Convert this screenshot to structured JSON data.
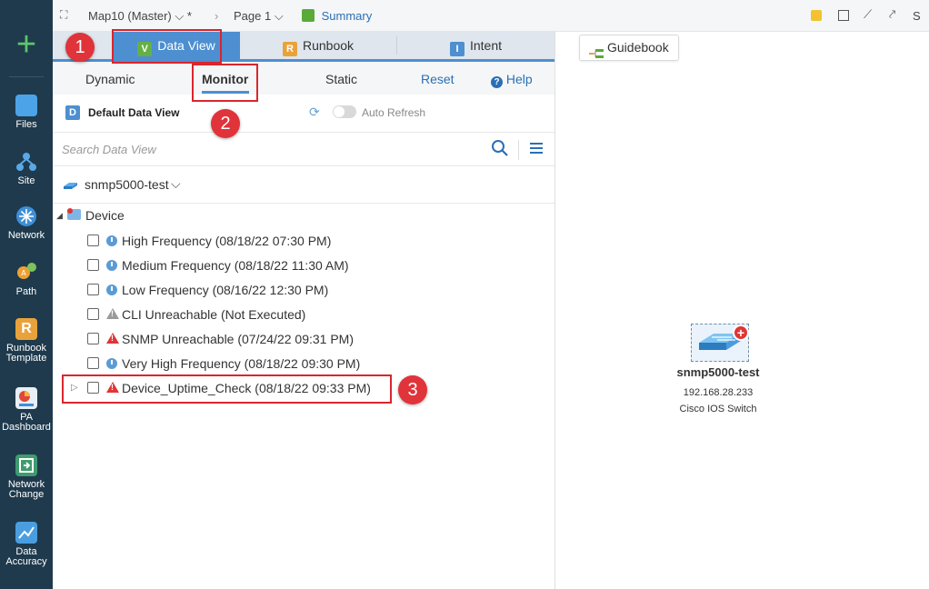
{
  "topbar": {
    "map_name": "Map10 (Master)",
    "dirty": "*",
    "page": "Page 1",
    "summary": "Summary",
    "right_clipped": "S"
  },
  "sidebar": {
    "items": [
      {
        "label": "Files",
        "icon": "folder-icon"
      },
      {
        "label": "Site",
        "icon": "site-icon"
      },
      {
        "label": "Network",
        "icon": "network-icon"
      },
      {
        "label": "Path",
        "icon": "path-icon"
      },
      {
        "label": "Runbook Template",
        "icon": "runbook-template-icon"
      },
      {
        "label": "PA Dashboard",
        "icon": "pa-dashboard-icon"
      },
      {
        "label": "Network Change",
        "icon": "network-change-icon"
      },
      {
        "label": "Data Accuracy",
        "icon": "data-accuracy-icon"
      }
    ]
  },
  "tabs": {
    "data_view": "Data View",
    "data_view_icon_letter": "V",
    "runbook": "Runbook",
    "runbook_icon_letter": "R",
    "intent": "Intent",
    "intent_icon_letter": "I"
  },
  "subtabs": {
    "dynamic": "Dynamic",
    "monitor": "Monitor",
    "static": "Static",
    "reset": "Reset",
    "help": "Help"
  },
  "data_view": {
    "badge": "D",
    "title": "Default Data View",
    "auto_refresh": "Auto Refresh"
  },
  "search": {
    "placeholder": "Search Data View"
  },
  "device_selector": {
    "label": "snmp5000-test"
  },
  "tree": {
    "root": "Device",
    "items": [
      {
        "label": "High Frequency (08/18/22 07:30 PM)",
        "status": "clock"
      },
      {
        "label": "Medium Frequency (08/18/22 11:30 AM)",
        "status": "clock"
      },
      {
        "label": "Low Frequency (08/16/22 12:30 PM)",
        "status": "clock"
      },
      {
        "label": "CLI Unreachable (Not Executed)",
        "status": "warning-grey"
      },
      {
        "label": "SNMP Unreachable (07/24/22 09:31 PM)",
        "status": "warning-red"
      },
      {
        "label": "Very High Frequency (08/18/22 09:30 PM)",
        "status": "clock"
      },
      {
        "label": "Device_Uptime_Check (08/18/22 09:33 PM)",
        "status": "warning-red"
      }
    ]
  },
  "callouts": [
    "1",
    "2",
    "3"
  ],
  "map": {
    "guidebook": "Guidebook",
    "device_name": "snmp5000-test",
    "device_ip": "192.168.28.233",
    "device_type": "Cisco IOS Switch"
  },
  "colors": {
    "sidebar_bg": "#1f3a4d",
    "accent": "#4d8fd0",
    "highlight": "#d8262d",
    "add": "#5cc66b"
  }
}
